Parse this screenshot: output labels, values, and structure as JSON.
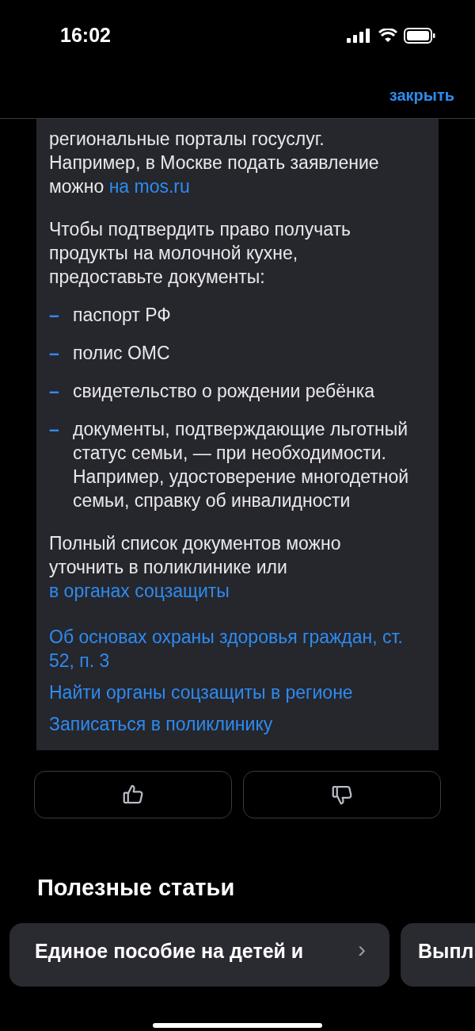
{
  "status_bar": {
    "time": "16:02"
  },
  "header": {
    "close_label": "закрыть"
  },
  "article": {
    "paragraphs_top": [
      {
        "segments": [
          {
            "text": "региональные порталы госуслуг. Например, в Москве подать заявление можно ",
            "link": false
          },
          {
            "text": "на mos.ru",
            "link": true
          }
        ]
      },
      {
        "segments": [
          {
            "text": "Чтобы подтвердить право получать продукты на молочной кухне, предоставьте документы:",
            "link": false
          }
        ]
      }
    ],
    "bullets": [
      {
        "marker": "–",
        "text": "паспорт РФ"
      },
      {
        "marker": "–",
        "text": "полис ОМС"
      },
      {
        "marker": "–",
        "text": "свидетельство о рождении ребёнка"
      },
      {
        "marker": "–",
        "text": "документы, подтверждающие льготный статус семьи, — при необходимости. Например, удостоверение многодетной семьи, справку об инвалидности"
      }
    ],
    "paragraphs_bottom": [
      {
        "segments": [
          {
            "text": "Полный список документов можно уточнить в поликлинике или ",
            "link": false
          },
          {
            "text": "в органах соцзащиты",
            "link": true
          }
        ]
      }
    ],
    "links": [
      "Об основах охраны здоровья граждан, ст. 52, п. 3",
      "Найти органы соцзащиты в регионе",
      "Записаться в поликлинику"
    ]
  },
  "feedback": [
    {
      "kind": "like"
    },
    {
      "kind": "dislike"
    }
  ],
  "useful_articles": {
    "title": "Полезные статьи",
    "cards": [
      {
        "title": "Единое пособие на детей и",
        "chevron": "›"
      },
      {
        "title": "Выпл"
      }
    ]
  }
}
